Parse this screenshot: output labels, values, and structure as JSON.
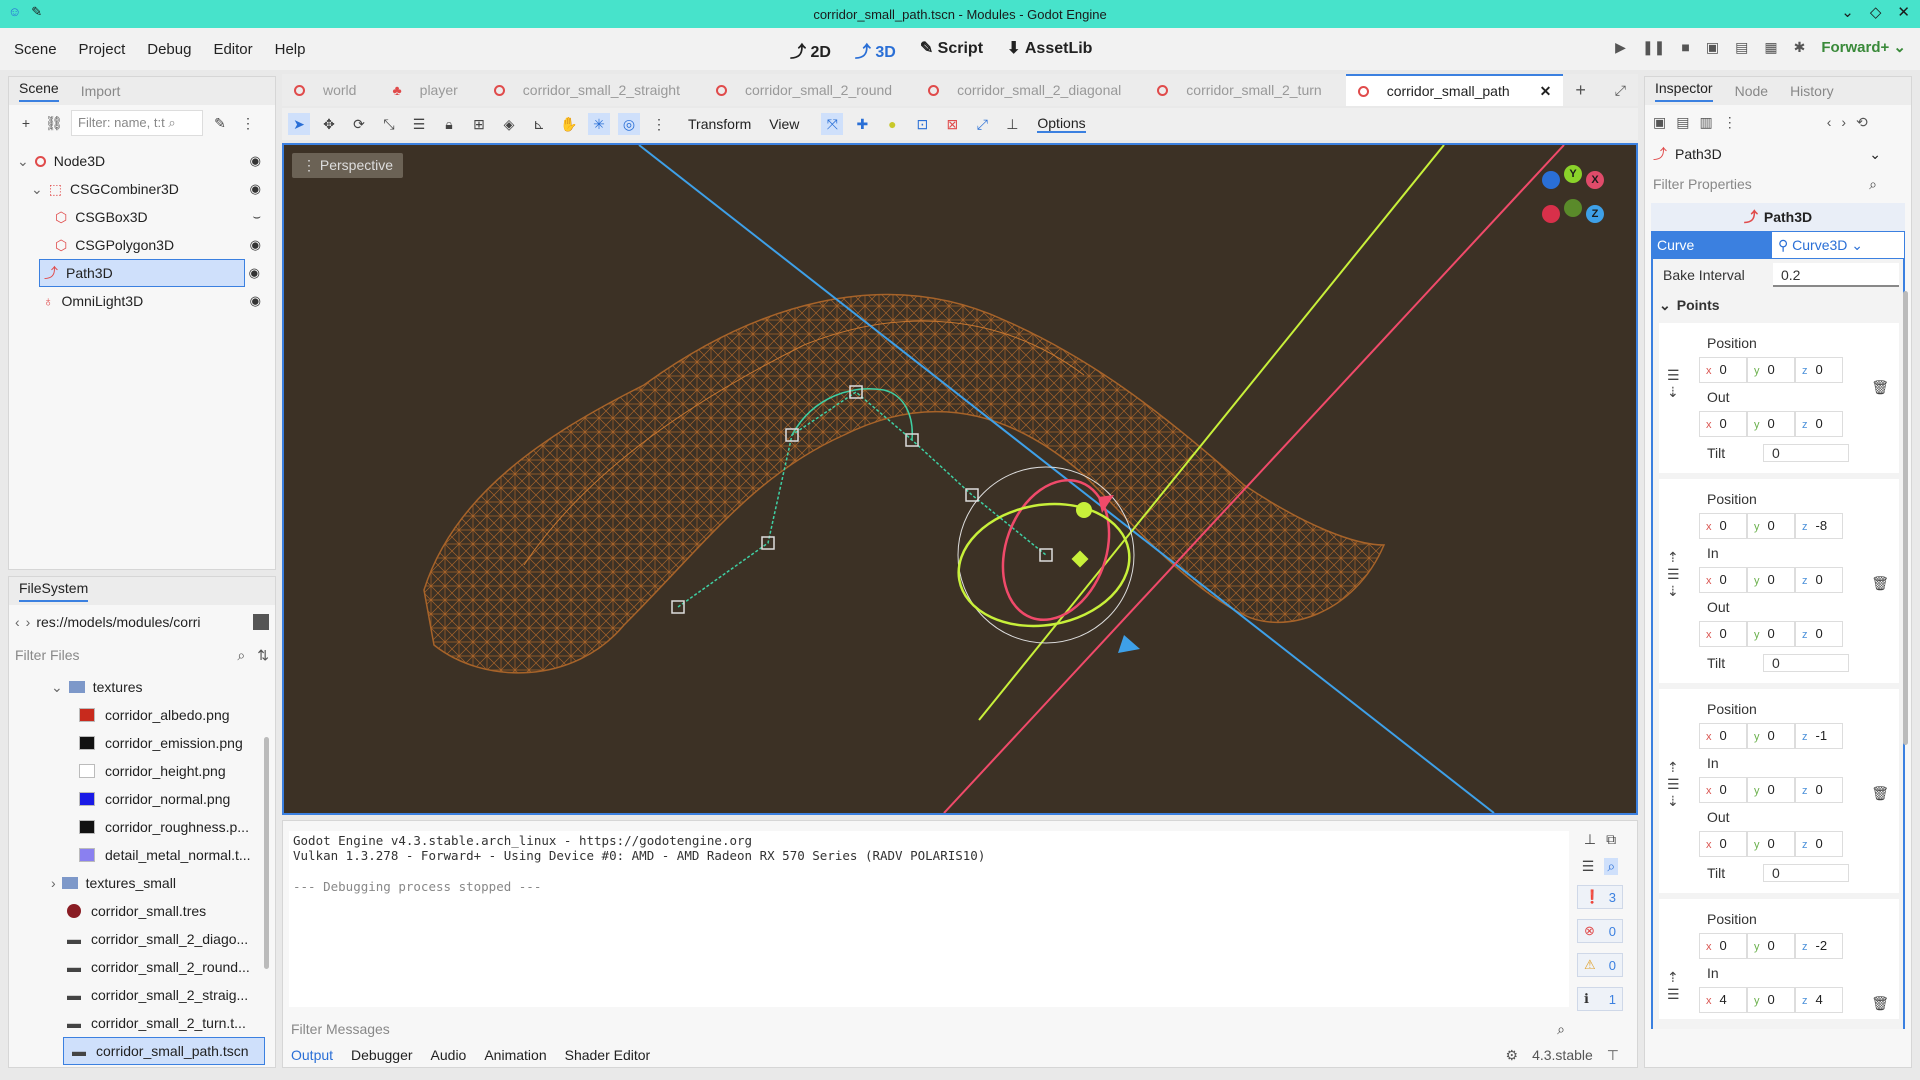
{
  "window": {
    "title": "corridor_small_path.tscn - Modules - Godot Engine"
  },
  "menu": {
    "items": [
      "Scene",
      "Project",
      "Debug",
      "Editor",
      "Help"
    ]
  },
  "workspaces": {
    "w2d": "2D",
    "w3d": "3D",
    "script": "Script",
    "assetlib": "AssetLib"
  },
  "renderer": "Forward+",
  "scene_dock": {
    "tabs": {
      "scene": "Scene",
      "import": "Import"
    },
    "filter_placeholder": "Filter: name, t:t",
    "nodes": [
      {
        "label": "Node3D"
      },
      {
        "label": "CSGCombiner3D"
      },
      {
        "label": "CSGBox3D"
      },
      {
        "label": "CSGPolygon3D"
      },
      {
        "label": "Path3D"
      },
      {
        "label": "OmniLight3D"
      }
    ]
  },
  "filesystem": {
    "title": "FileSystem",
    "path": "res://models/modules/corri",
    "filter_placeholder": "Filter Files",
    "items": [
      {
        "label": "textures",
        "color": ""
      },
      {
        "label": "corridor_albedo.png",
        "color": "#c82a1d"
      },
      {
        "label": "corridor_emission.png",
        "color": "#111111"
      },
      {
        "label": "corridor_height.png",
        "color": "#ffffff"
      },
      {
        "label": "corridor_normal.png",
        "color": "#1a1ae6"
      },
      {
        "label": "corridor_roughness.p...",
        "color": "#111111"
      },
      {
        "label": "detail_metal_normal.t...",
        "color": "#8a80f0"
      },
      {
        "label": "textures_small",
        "color": ""
      },
      {
        "label": "corridor_small.tres",
        "color": ""
      },
      {
        "label": "corridor_small_2_diago...",
        "color": ""
      },
      {
        "label": "corridor_small_2_round...",
        "color": ""
      },
      {
        "label": "corridor_small_2_straig...",
        "color": ""
      },
      {
        "label": "corridor_small_2_turn.t...",
        "color": ""
      },
      {
        "label": "corridor_small_path.tscn",
        "color": ""
      }
    ]
  },
  "scene_tabs": [
    "world",
    "player",
    "corridor_small_2_straight",
    "corridor_small_2_round",
    "corridor_small_2_diagonal",
    "corridor_small_2_turn",
    "corridor_small_path"
  ],
  "toolbar": {
    "transform": "Transform",
    "view": "View",
    "options": "Options"
  },
  "viewport": {
    "perspective": "Perspective",
    "gizmo": {
      "x": "X",
      "y": "Y",
      "z": "Z"
    }
  },
  "output": {
    "lines": [
      "Godot Engine v4.3.stable.arch_linux - https://godotengine.org",
      "Vulkan 1.3.278 - Forward+ - Using Device #0: AMD - AMD Radeon RX 570 Series (RADV POLARIS10)",
      "",
      "--- Debugging process stopped ---"
    ],
    "filter_placeholder": "Filter Messages",
    "counts": {
      "messages": "3",
      "errors": "0",
      "warnings": "0",
      "info": "1"
    },
    "tabs": [
      "Output",
      "Debugger",
      "Audio",
      "Animation",
      "Shader Editor"
    ],
    "version": "4.3.stable"
  },
  "inspector": {
    "tabs": {
      "inspector": "Inspector",
      "node": "Node",
      "history": "History"
    },
    "node": "Path3D",
    "filter_placeholder": "Filter Properties",
    "class": "Path3D",
    "curve_label": "Curve",
    "curve_value": "Curve3D",
    "bake_label": "Bake Interval",
    "bake_value": "0.2",
    "points_label": "Points",
    "labels": {
      "position": "Position",
      "in": "In",
      "out": "Out",
      "tilt": "Tilt"
    },
    "points": [
      {
        "pos": [
          "0",
          "0",
          "0"
        ],
        "in": null,
        "out": [
          "0",
          "0",
          "0"
        ],
        "tilt": "0"
      },
      {
        "pos": [
          "0",
          "0",
          "-8"
        ],
        "in": [
          "0",
          "0",
          "0"
        ],
        "out": [
          "0",
          "0",
          "0"
        ],
        "tilt": "0"
      },
      {
        "pos": [
          "0",
          "0",
          "-1"
        ],
        "in": [
          "0",
          "0",
          "0"
        ],
        "out": [
          "0",
          "0",
          "0"
        ],
        "tilt": "0"
      },
      {
        "pos": [
          "0",
          "0",
          "-2"
        ],
        "in": [
          "4",
          "0",
          "4"
        ],
        "out": null,
        "tilt": null
      }
    ]
  }
}
